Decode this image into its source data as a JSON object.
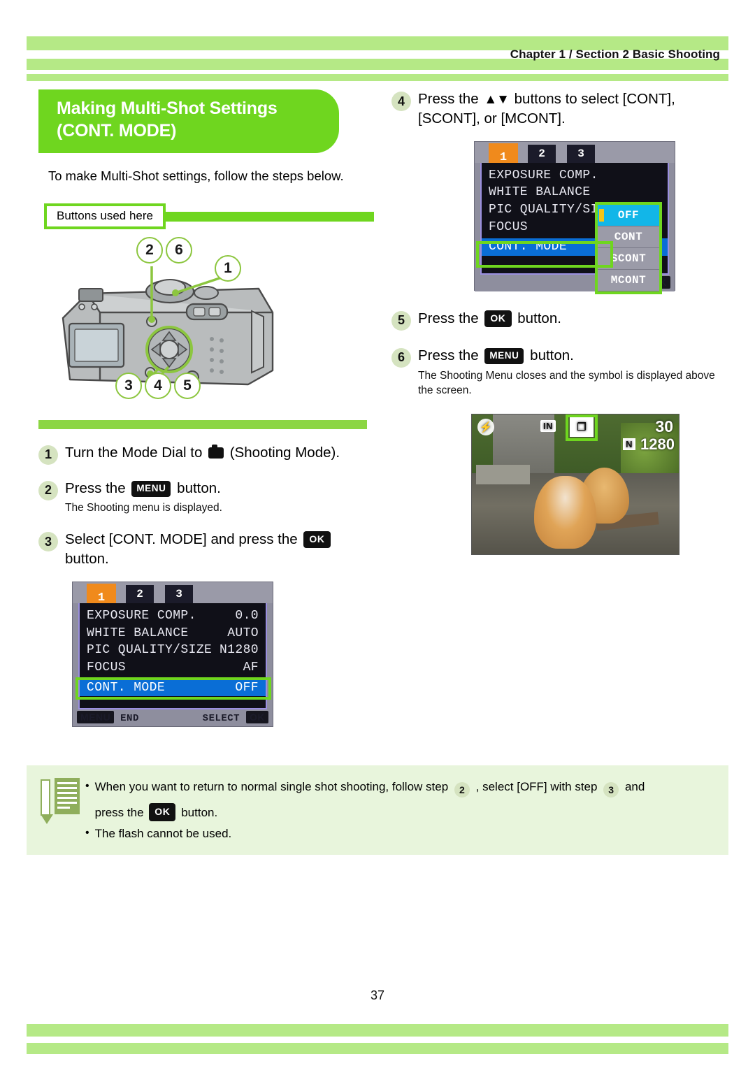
{
  "header": {
    "chapter": "Chapter 1 / Section 2  Basic Shooting"
  },
  "title": {
    "line1": "Making Multi-Shot Settings",
    "line2": "(CONT. MODE)"
  },
  "intro": "To make Multi-Shot settings, follow the steps below.",
  "buttons_used": {
    "label": "Buttons used here"
  },
  "camera_figure": {
    "callouts": [
      "2",
      "6",
      "1",
      "3",
      "4",
      "5"
    ]
  },
  "steps_left": [
    {
      "num": "1",
      "text_before": "Turn the Mode Dial to",
      "icon": "camera-icon",
      "text_after": "(Shooting Mode).",
      "sub": ""
    },
    {
      "num": "2",
      "text_before": "Press the",
      "key": "MENU",
      "text_after": "button.",
      "sub": "The Shooting menu is displayed."
    },
    {
      "num": "3",
      "text_before": "Select [CONT. MODE] and press the",
      "key": "OK",
      "text_after": "button.",
      "sub": ""
    }
  ],
  "steps_right": [
    {
      "num": "4",
      "text_before": "Press the",
      "arrows": "▲▼",
      "text_after": "buttons to select [CONT], [SCONT], or [MCONT].",
      "sub": ""
    },
    {
      "num": "5",
      "text_before": "Press the",
      "key": "OK",
      "text_after": "button.",
      "sub": ""
    },
    {
      "num": "6",
      "text_before": "Press the",
      "key": "MENU",
      "text_after": "button.",
      "sub": "The Shooting Menu closes and the symbol is displayed above the screen."
    }
  ],
  "lcd_left": {
    "tabs": [
      "1",
      "2",
      "3"
    ],
    "rows": [
      {
        "label": "EXPOSURE COMP.",
        "value": "0.0"
      },
      {
        "label": "WHITE BALANCE",
        "value": "AUTO"
      },
      {
        "label": "PIC QUALITY/SIZE",
        "value": "N1280"
      },
      {
        "label": "FOCUS",
        "value": "AF"
      },
      {
        "label": "CONT. MODE",
        "value": "OFF"
      }
    ],
    "footer_left_key": "MENU",
    "footer_left_text": "END",
    "footer_right_text": "SELECT",
    "footer_right_key": "OK"
  },
  "lcd_right": {
    "tabs": [
      "1",
      "2",
      "3"
    ],
    "rows": [
      {
        "label": "EXPOSURE COMP.",
        "value": ""
      },
      {
        "label": "WHITE BALANCE",
        "value": ""
      },
      {
        "label": "PIC QUALITY/SIZE",
        "value": ""
      },
      {
        "label": "FOCUS",
        "value": ""
      },
      {
        "label": "CONT. MODE",
        "value": ""
      }
    ],
    "dropdown": [
      "OFF",
      "CONT",
      "SCONT",
      "MCONT"
    ],
    "dropdown_selected": "OFF",
    "footer_right_text": "OK",
    "footer_right_key": "OK"
  },
  "photo_overlay": {
    "flash_icon": "flash-off-icon",
    "memory": "IN",
    "cont_icon": "multi-shot-icon",
    "remaining": "30",
    "quality": "N",
    "size": "1280"
  },
  "note": {
    "line1_a": "When you want to return to normal single shot shooting, follow step",
    "line1_num1": "2",
    "line1_b": ", select [OFF] with step",
    "line1_num2": "3",
    "line1_c": "and",
    "line2_a": "press the",
    "line2_key": "OK",
    "line2_b": "button.",
    "line3": "The flash cannot be used.",
    "bullet": "•"
  },
  "footer": {
    "page_number": "37"
  },
  "colors": {
    "band_light_green": "#b5e986",
    "brand_green": "#6fd61f",
    "step_circle": "#d5e3c0",
    "note_bg": "#e8f5dc",
    "lcd_select_blue": "#0a6ed6",
    "lcd_active_cyan": "#12b6e8",
    "tab_orange": "#f08a1c"
  }
}
